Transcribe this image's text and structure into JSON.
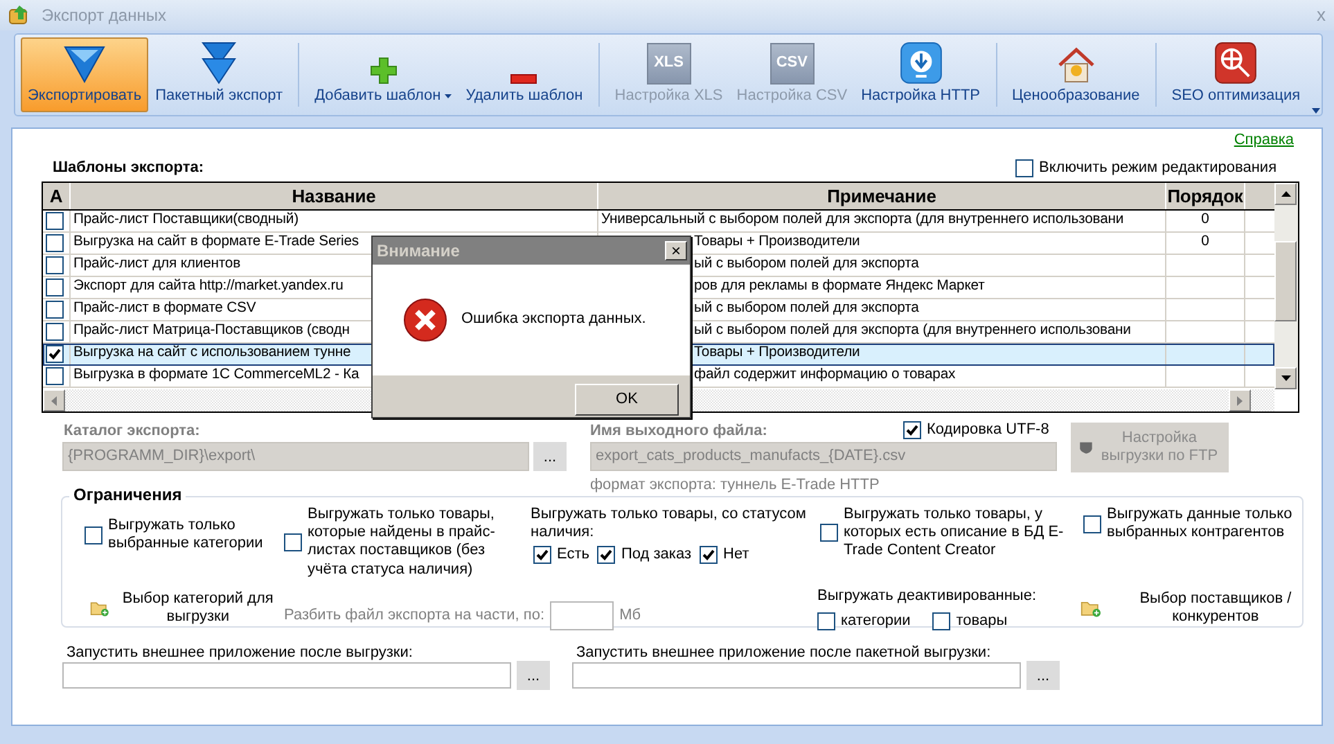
{
  "window": {
    "title": "Экспорт данных",
    "close": "x"
  },
  "toolbar": [
    {
      "buttons": [
        {
          "label": "Экспортировать",
          "kind": "export",
          "selected": true,
          "disabled": false,
          "dropdown": false
        },
        {
          "label": "Пакетный экспорт",
          "kind": "batch",
          "selected": false,
          "disabled": false,
          "dropdown": false
        }
      ]
    },
    {
      "buttons": [
        {
          "label": "Добавить шаблон",
          "kind": "add",
          "selected": false,
          "disabled": false,
          "dropdown": true
        },
        {
          "label": "Удалить шаблон",
          "kind": "remove",
          "selected": false,
          "disabled": false,
          "dropdown": false
        }
      ]
    },
    {
      "buttons": [
        {
          "label": "Настройка XLS",
          "kind": "xls",
          "icon_text": "XLS",
          "selected": false,
          "disabled": true,
          "dropdown": false
        },
        {
          "label": "Настройка CSV",
          "kind": "csv",
          "icon_text": "CSV",
          "selected": false,
          "disabled": true,
          "dropdown": false
        },
        {
          "label": "Настройка HTTP",
          "kind": "http",
          "selected": false,
          "disabled": false,
          "dropdown": false
        }
      ]
    },
    {
      "buttons": [
        {
          "label": "Ценообразование",
          "kind": "price",
          "selected": false,
          "disabled": false,
          "dropdown": false
        }
      ]
    },
    {
      "buttons": [
        {
          "label": "SEO оптимизация",
          "kind": "seo",
          "selected": false,
          "disabled": false,
          "dropdown": false
        }
      ]
    }
  ],
  "help_link": "Справка",
  "templates": {
    "title": "Шаблоны экспорта:",
    "edit_mode": {
      "label": "Включить режим редактирования",
      "checked": false
    },
    "columns": [
      "А",
      "Название",
      "Примечание",
      "Порядок"
    ],
    "rows": [
      {
        "checked": false,
        "selected": false,
        "name": "Прайс-лист Поставщики(сводный)",
        "note": "Универсальный с выбором полей для экспорта (для внутреннего использовани",
        "order": "0",
        "note_partly_hidden": false
      },
      {
        "checked": false,
        "selected": false,
        "name": "Выгрузка на сайт в формате E-Trade Series",
        "note": "Товары + Производители",
        "order": "0",
        "note_partly_hidden": true
      },
      {
        "checked": false,
        "selected": false,
        "name": "Прайс-лист для клиентов",
        "note": "ый с выбором полей для экспорта",
        "note_partly_hidden": true
      },
      {
        "checked": false,
        "selected": false,
        "name": "Экспорт для сайта http://market.yandex.ru",
        "note": "ров для рекламы в формате Яндекс Маркет",
        "note_partly_hidden": true
      },
      {
        "checked": false,
        "selected": false,
        "name": "Прайс-лист в формате CSV",
        "note": "ый с выбором полей для экспорта",
        "note_partly_hidden": true
      },
      {
        "checked": false,
        "selected": false,
        "name": "Прайс-лист Матрица-Поставщиков (сводн",
        "note": "ый с выбором полей для экспорта (для внутреннего использовани",
        "note_partly_hidden": true
      },
      {
        "checked": true,
        "selected": true,
        "name": "Выгрузка на сайт с использованием тунне",
        "note": "Товары + Производители",
        "note_partly_hidden": true
      },
      {
        "checked": false,
        "selected": false,
        "name": "Выгрузка в формате 1С CommerceML2 - Ка",
        "note": "файл содержит информацию о товарах",
        "note_partly_hidden": true
      }
    ]
  },
  "catalog": {
    "label": "Каталог экспорта:",
    "value": "{PROGRAMM_DIR}\\export\\",
    "browse": "...",
    "disabled": true
  },
  "output_file": {
    "label": "Имя выходного файла:",
    "value": "export_cats_products_manufacts_{DATE}.csv",
    "format_note": "формат экспорта: туннель E-Trade HTTP",
    "disabled": true
  },
  "utf8": {
    "label": "Кодировка UTF-8",
    "checked": true
  },
  "ftp_button": {
    "label": "Настройка выгрузки по FTP",
    "disabled": true
  },
  "restrictions": {
    "title": "Ограничения",
    "only_categories": {
      "label": "Выгружать только выбранные категории",
      "checked": false
    },
    "choose_categories": "Выбор категорий для выгрузки",
    "only_found": {
      "label": "Выгружать только товары, которые найдены в прайс-листах поставщиков (без учёта статуса наличия)",
      "checked": false
    },
    "split": {
      "label": "Разбить файл экспорта на части, по:",
      "unit": "Мб",
      "disabled": true
    },
    "status_title": "Выгружать только товары, со статусом наличия:",
    "statuses": [
      {
        "label": "Есть",
        "checked": true
      },
      {
        "label": "Под заказ",
        "checked": true
      },
      {
        "label": "Нет",
        "checked": true
      }
    ],
    "only_described": {
      "label": "Выгружать только товары, у которых есть описание в БД E-Trade Content Creator",
      "checked": false
    },
    "deactivated_title": "Выгружать деактивированные:",
    "deactivated": [
      {
        "label": "категории",
        "checked": false
      },
      {
        "label": "товары",
        "checked": false
      }
    ],
    "only_contractors": {
      "label": "Выгружать данные только выбранных контрагентов",
      "checked": false
    },
    "choose_suppliers": "Выбор поставщиков / конкурентов"
  },
  "run_after": [
    {
      "label": "Запустить внешнее приложение после выгрузки:",
      "browse": "..."
    },
    {
      "label": "Запустить внешнее приложение после пакетной выгрузки:",
      "browse": "..."
    }
  ],
  "dialog": {
    "title": "Внимание",
    "close": "×",
    "message": "Ошибка экспорта данных.",
    "button": "OK"
  }
}
